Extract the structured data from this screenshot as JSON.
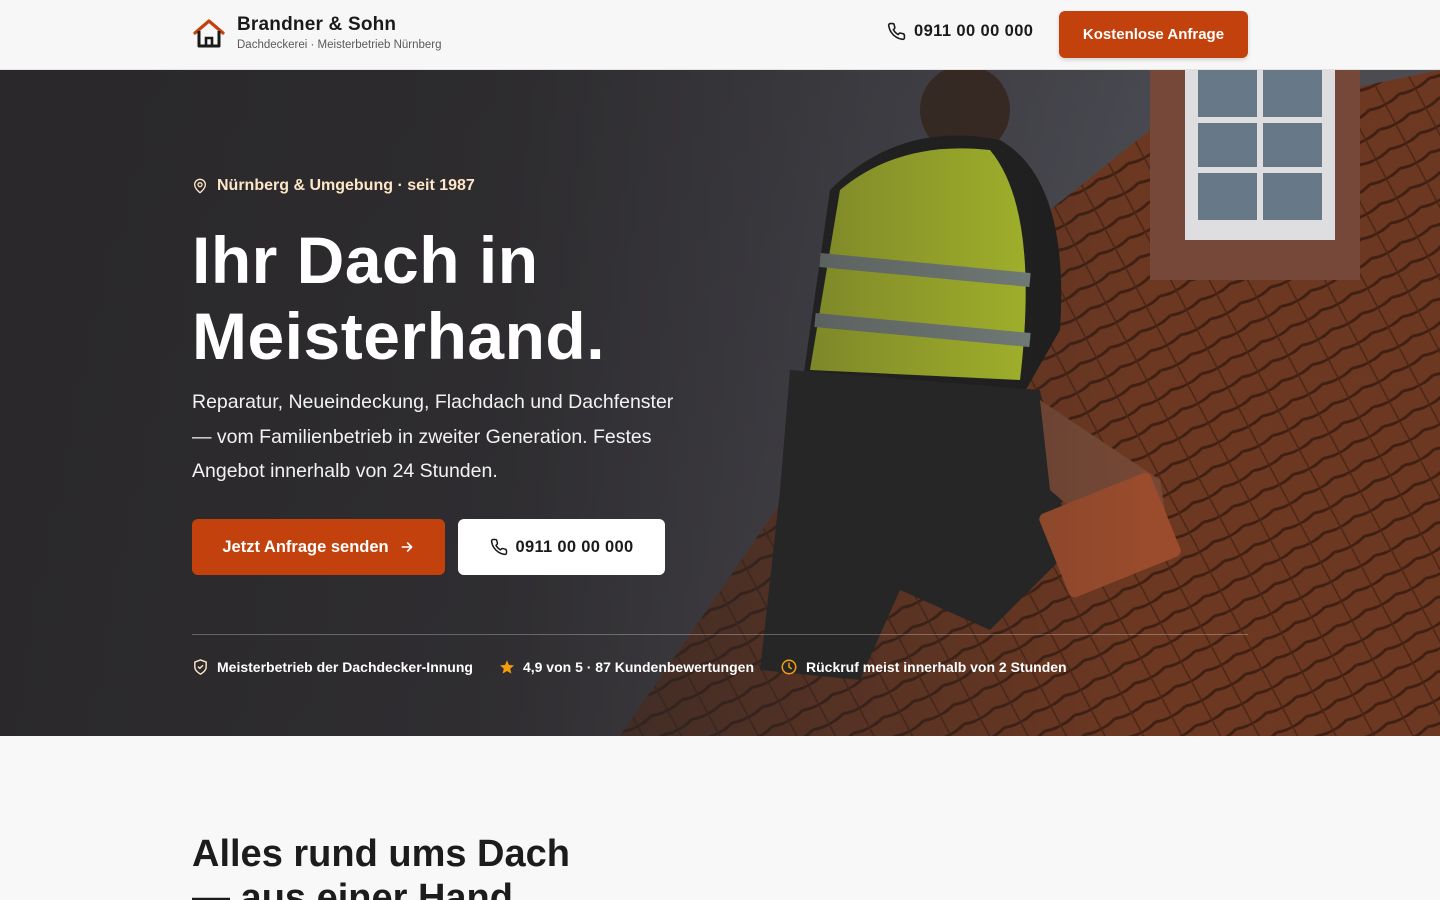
{
  "header": {
    "brand_name": "Brandner & Sohn",
    "brand_sub": "Dachdeckerei · Meisterbetrieb Nürnberg",
    "phone": "0911 00 00 000",
    "cta": "Kostenlose Anfrage"
  },
  "hero": {
    "location": "Nürnberg & Umgebung · seit 1987",
    "title": "Ihr Dach in Meisterhand.",
    "text": "Reparatur, Neueindeckung, Flachdach und Dachfenster — vom Familienbetrieb in zweiter Generation. Festes Angebot innerhalb von 24 Stunden.",
    "primary_button": "Jetzt Anfrage senden",
    "secondary_button": "0911 00 00 000",
    "trust": [
      {
        "icon": "shield-check-icon",
        "label": "Meisterbetrieb der Dachdecker-Innung"
      },
      {
        "icon": "star-icon",
        "label": "4,9 von 5 · 87 Kundenbewertungen"
      },
      {
        "icon": "clock-icon",
        "label": "Rückruf meist innerhalb von 2 Stunden"
      }
    ]
  },
  "section": {
    "title": "Alles rund ums Dach — aus einer Hand"
  },
  "colors": {
    "accent": "#c2410c",
    "location_text": "#fde7c8",
    "star": "#f59e0b"
  }
}
